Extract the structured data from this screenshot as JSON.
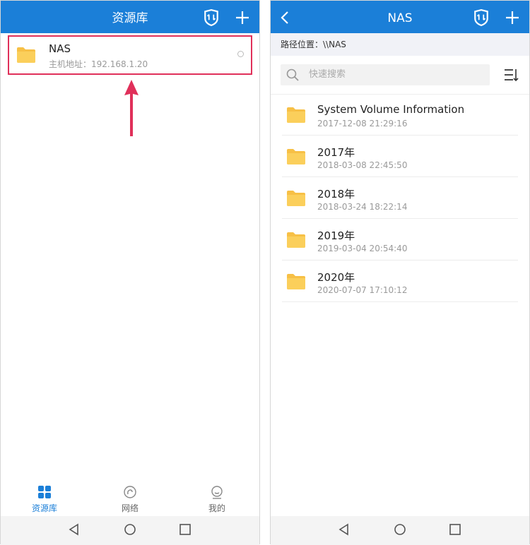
{
  "left": {
    "appbar": {
      "title": "资源库"
    },
    "server": {
      "name": "NAS",
      "address_label": "主机地址：",
      "address": "192.168.1.20"
    },
    "tabs": [
      {
        "label": "资源库",
        "icon": "grid-icon",
        "active": true
      },
      {
        "label": "网络",
        "icon": "network-icon",
        "active": false
      },
      {
        "label": "我的",
        "icon": "profile-icon",
        "active": false
      }
    ]
  },
  "right": {
    "appbar": {
      "title": "NAS"
    },
    "path": {
      "label": "路径位置：",
      "value": "\\\\NAS"
    },
    "search": {
      "placeholder": "快速搜索"
    },
    "files": [
      {
        "name": "System Volume Information",
        "date": "2017-12-08 21:29:16"
      },
      {
        "name": "2017年",
        "date": "2018-03-08 22:45:50"
      },
      {
        "name": "2018年",
        "date": "2018-03-24 18:22:14"
      },
      {
        "name": "2019年",
        "date": "2019-03-04 20:54:40"
      },
      {
        "name": "2020年",
        "date": "2020-07-07 17:10:12"
      }
    ]
  },
  "colors": {
    "primary": "#1b7fd8",
    "highlight": "#e0305a",
    "folder": "#f7c046"
  }
}
